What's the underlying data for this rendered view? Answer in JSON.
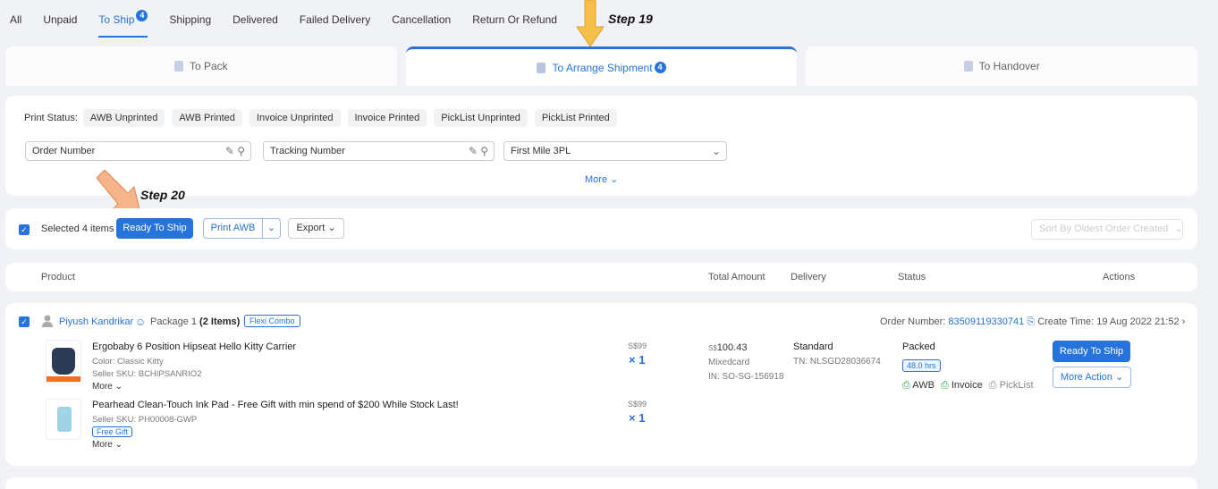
{
  "tabs": {
    "items": [
      {
        "label": "All"
      },
      {
        "label": "Unpaid"
      },
      {
        "label": "To Ship",
        "badge": "4"
      },
      {
        "label": "Shipping"
      },
      {
        "label": "Delivered"
      },
      {
        "label": "Failed Delivery"
      },
      {
        "label": "Cancellation"
      },
      {
        "label": "Return Or Refund"
      }
    ],
    "active": "To Ship"
  },
  "annotations": {
    "step19": "Step 19",
    "step20": "Step 20",
    "arrow_color": "#f3b23c"
  },
  "subtabs": [
    {
      "label": "To Pack"
    },
    {
      "label": "To Arrange Shipment",
      "badge": "4"
    },
    {
      "label": "To Handover"
    }
  ],
  "filters": {
    "print_status_label": "Print Status:",
    "chips": [
      "AWB Unprinted",
      "AWB Printed",
      "Invoice Unprinted",
      "Invoice Printed",
      "PickList Unprinted",
      "PickList Printed"
    ],
    "order_number_placeholder": "Order Number",
    "tracking_number_placeholder": "Tracking Number",
    "first_mile_value": "First Mile 3PL",
    "more_label": "More"
  },
  "toolbar": {
    "selected_label": "Selected 4 items",
    "ready_label": "Ready To Ship",
    "print_awb_label": "Print AWB",
    "export_label": "Export",
    "sort_label": "Sort By",
    "sort_value": "Oldest Order Created"
  },
  "table_header": {
    "product": "Product",
    "total": "Total Amount",
    "delivery": "Delivery",
    "status": "Status",
    "actions": "Actions"
  },
  "order": {
    "buyer": "Piyush Kandrikar",
    "package": "Package 1",
    "items_count": "(2 Items)",
    "combo_tag": "Flexi Combo",
    "order_number_label": "Order Number:",
    "order_number": "83509119330741",
    "create_time": "Create Time: 19 Aug 2022 21:52",
    "products": [
      {
        "name": "Ergobaby 6 Position Hipseat Hello Kitty Carrier",
        "variant": "Color: Classic Kitty",
        "sku": "Seller SKU: BCHIPSANRIO2",
        "price": "S$99",
        "qty": "× 1",
        "more": "More"
      },
      {
        "name": "Pearhead Clean-Touch Ink Pad - Free Gift with min spend of $200 While Stock Last!",
        "sku": "Seller SKU: PH00008-GWP",
        "tag": "Free Gift",
        "price": "S$99",
        "qty": "× 1",
        "more": "More"
      }
    ],
    "total_currency": "S$",
    "total": "100.43",
    "payment": "Mixedcard",
    "invoice_no": "IN: SO-SG-156918",
    "delivery_type": "Standard",
    "tracking": "TN: NLSGD28036674",
    "status": "Packed",
    "hours": "48.0 hrs",
    "docs": [
      "AWB",
      "Invoice",
      "PickList"
    ],
    "ready_label": "Ready To Ship",
    "more_action_label": "More Action"
  },
  "colors": {
    "accent": "#2673dd",
    "green": "#2aa14c"
  }
}
